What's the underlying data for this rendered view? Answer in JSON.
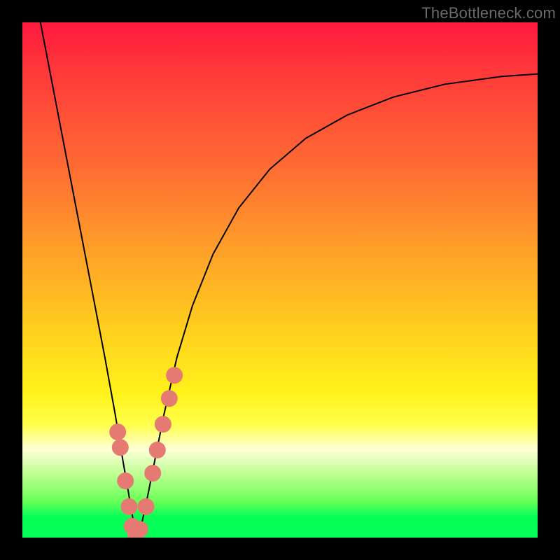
{
  "watermark": "TheBottleneck.com",
  "chart_data": {
    "type": "line",
    "title": "",
    "xlabel": "",
    "ylabel": "",
    "xlim": [
      0,
      1
    ],
    "ylim": [
      0,
      1
    ],
    "grid": false,
    "legend": false,
    "background": {
      "gradient": {
        "top_color": "#ff1a3e",
        "mid_color": "#fff21a",
        "bottom_color": "#06ff57",
        "meaning": "red = high bottleneck, green = low bottleneck"
      }
    },
    "series": [
      {
        "name": "bottleneck-curve",
        "color": "#000000",
        "stroke_width": 2,
        "x": [
          0.035,
          0.06,
          0.085,
          0.11,
          0.135,
          0.16,
          0.18,
          0.195,
          0.208,
          0.216,
          0.223,
          0.23,
          0.24,
          0.255,
          0.275,
          0.3,
          0.33,
          0.37,
          0.42,
          0.48,
          0.55,
          0.63,
          0.72,
          0.82,
          0.93,
          1.0
        ],
        "values": [
          1.0,
          0.87,
          0.74,
          0.61,
          0.48,
          0.35,
          0.24,
          0.15,
          0.075,
          0.028,
          0.006,
          0.02,
          0.065,
          0.14,
          0.24,
          0.35,
          0.45,
          0.55,
          0.64,
          0.715,
          0.775,
          0.82,
          0.855,
          0.88,
          0.895,
          0.9
        ]
      },
      {
        "name": "sample-points",
        "type": "scatter",
        "color": "#e57a73",
        "marker_radius": 12,
        "x": [
          0.185,
          0.19,
          0.2,
          0.207,
          0.213,
          0.22,
          0.228,
          0.24,
          0.253,
          0.262,
          0.273,
          0.285,
          0.295
        ],
        "values": [
          0.205,
          0.175,
          0.11,
          0.06,
          0.022,
          0.006,
          0.016,
          0.06,
          0.125,
          0.17,
          0.22,
          0.27,
          0.315
        ]
      }
    ],
    "min_point": {
      "x": 0.22,
      "value": 0.005
    },
    "note": "Axes are unlabeled in the source image; x/y are normalized 0–1 positions within the plot area. 'values' decreasing toward 0 correspond to the green (no bottleneck) region."
  }
}
